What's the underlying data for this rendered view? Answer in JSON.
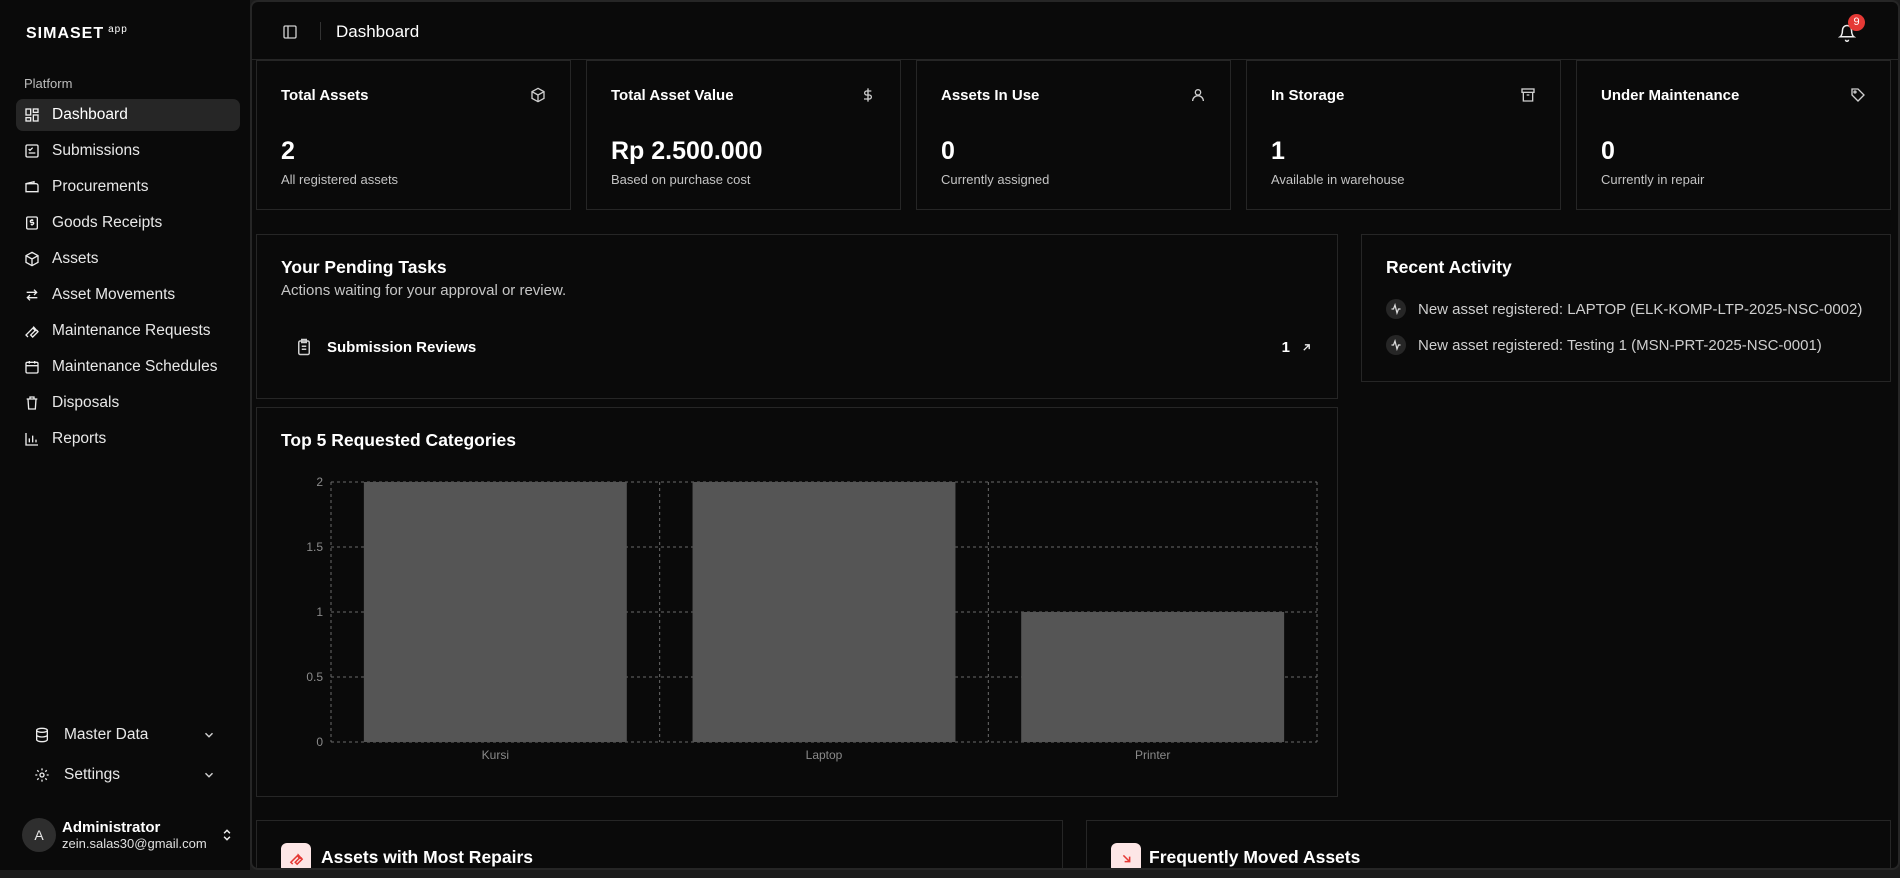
{
  "sidebar": {
    "brand": "SIMASET",
    "brand_suffix": "app",
    "group_label": "Platform",
    "items": [
      {
        "label": "Dashboard",
        "icon": "layout-dashboard-icon",
        "active": true
      },
      {
        "label": "Submissions",
        "icon": "clipboard-check-icon"
      },
      {
        "label": "Procurements",
        "icon": "wallet-icon"
      },
      {
        "label": "Goods Receipts",
        "icon": "receipt-icon"
      },
      {
        "label": "Assets",
        "icon": "package-icon"
      },
      {
        "label": "Asset Movements",
        "icon": "arrows-right-left-icon"
      },
      {
        "label": "Maintenance Requests",
        "icon": "wrench-icon"
      },
      {
        "label": "Maintenance Schedules",
        "icon": "calendar-icon"
      },
      {
        "label": "Disposals",
        "icon": "trash-icon"
      },
      {
        "label": "Reports",
        "icon": "bar-chart-icon"
      }
    ],
    "master_data": "Master Data",
    "settings": "Settings",
    "user": {
      "initial": "A",
      "name": "Administrator",
      "email": "zein.salas30@gmail.com"
    }
  },
  "header": {
    "title": "Dashboard",
    "notification_count": "9"
  },
  "stats": [
    {
      "title": "Total Assets",
      "value": "2",
      "sub": "All registered assets",
      "icon": "box-icon"
    },
    {
      "title": "Total Asset Value",
      "value": "Rp 2.500.000",
      "sub": "Based on purchase cost",
      "icon": "dollar-icon"
    },
    {
      "title": "Assets In Use",
      "value": "0",
      "sub": "Currently assigned",
      "icon": "user-icon"
    },
    {
      "title": "In Storage",
      "value": "1",
      "sub": "Available in warehouse",
      "icon": "archive-icon"
    },
    {
      "title": "Under Maintenance",
      "value": "0",
      "sub": "Currently in repair",
      "icon": "tag-icon"
    }
  ],
  "pending": {
    "title": "Your Pending Tasks",
    "subtitle": "Actions waiting for your approval or review.",
    "tasks": [
      {
        "label": "Submission Reviews",
        "count": "1"
      }
    ]
  },
  "activity": {
    "title": "Recent Activity",
    "items": [
      "New asset registered: LAPTOP (ELK-KOMP-LTP-2025-NSC-0002)",
      "New asset registered: Testing 1 (MSN-PRT-2025-NSC-0001)"
    ]
  },
  "chart_card": {
    "title": "Top 5 Requested Categories"
  },
  "chart_data": {
    "type": "bar",
    "categories": [
      "Kursi",
      "Laptop",
      "Printer"
    ],
    "values": [
      2,
      2,
      1
    ],
    "yticks": [
      "0",
      "0.5",
      "1",
      "1.5",
      "2"
    ],
    "ylim": [
      0,
      2
    ],
    "grid": true,
    "bar_color": "#555555"
  },
  "bottom": {
    "repairs_title": "Assets with Most Repairs",
    "moved_title": "Frequently Moved Assets"
  }
}
